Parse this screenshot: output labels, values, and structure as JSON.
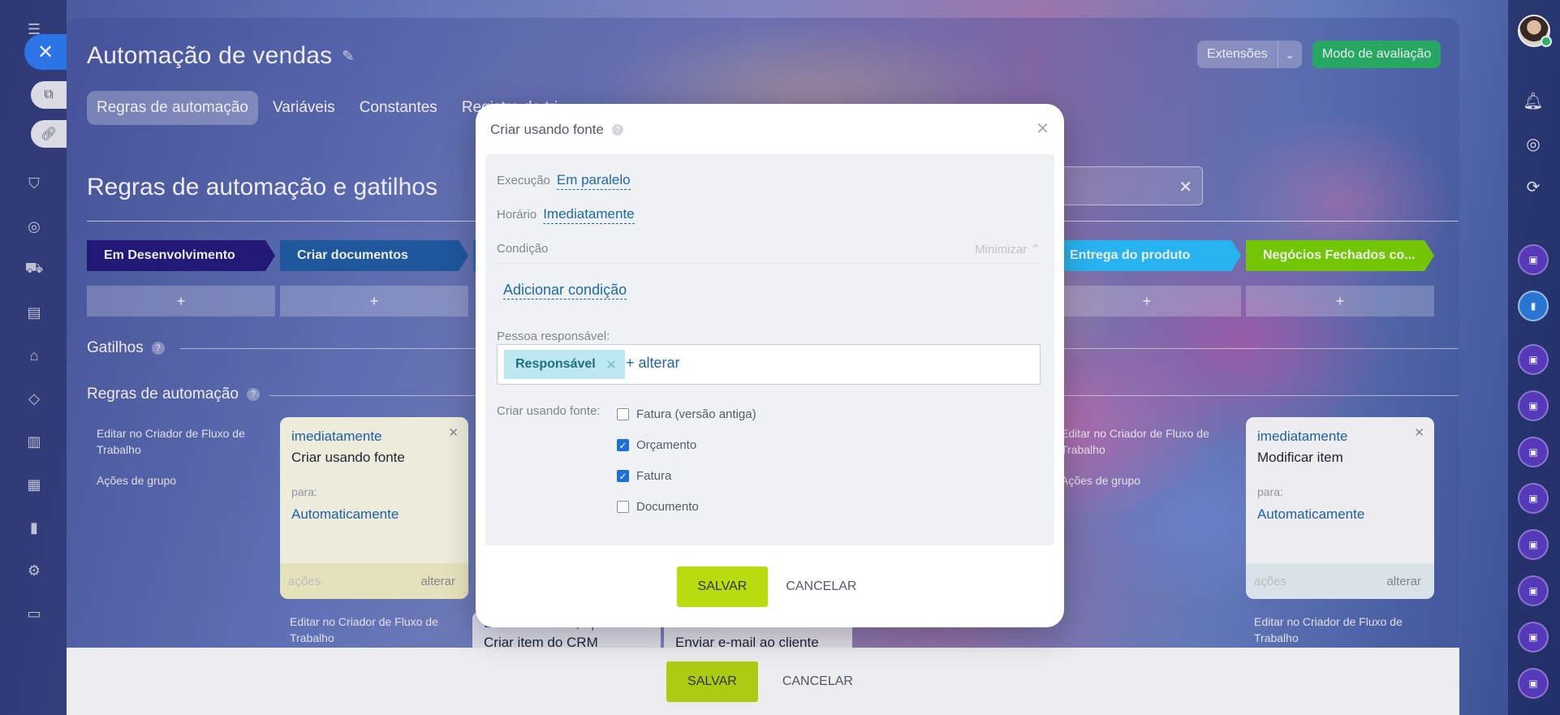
{
  "page": {
    "title": "Automação de vendas",
    "tabs": [
      {
        "label": "Regras de automação"
      },
      {
        "label": "Variáveis"
      },
      {
        "label": "Constantes"
      },
      {
        "label": "Registro de tri"
      }
    ],
    "extensions_label": "Extensões",
    "evaluation_label": "Modo de avaliação",
    "section_title": "Regras de automação e gatilhos"
  },
  "stages": [
    {
      "label": "Em Desenvolvimento",
      "color": "#23187a"
    },
    {
      "label": "Criar documentos",
      "color": "#1f5da3"
    },
    {
      "label": "",
      "color": "#2b72c4"
    },
    {
      "label": "Entrega do produto",
      "color": "#29c1ff"
    },
    {
      "label": "Negócios Fechados co...",
      "color": "#7bd500"
    }
  ],
  "add_label": "+",
  "triggers_label": "Gatilhos",
  "rules_label": "Regras de automação",
  "side_links": {
    "edit_designer": "Editar no Criador de Fluxo de Trabalho",
    "group_actions": "Ações de grupo"
  },
  "cards": [
    {
      "when": "imediatamente",
      "name": "Criar usando fonte",
      "para": "para:",
      "target": "Automaticamente",
      "actions": "ações",
      "alter": "alterar"
    },
    {
      "when": "imediatamente",
      "name": "Modificar item",
      "para": "para:",
      "target": "Automaticamente",
      "actions": "ações",
      "alter": "alterar"
    }
  ],
  "lower_cards": [
    {
      "line1": "Em 10 minutos, após a...",
      "line2": "Criar item do CRM"
    },
    {
      "line1": "imediatamente",
      "line2": "Enviar e-mail ao cliente"
    }
  ],
  "bottom_bar": {
    "save": "SALVAR",
    "cancel": "CANCELAR"
  },
  "modal": {
    "title": "Criar usando fonte",
    "execution_label": "Execução",
    "execution_value": "Em paralelo",
    "time_label": "Horário",
    "time_value": "Imediatamente",
    "condition_label": "Condição",
    "minimize_label": "Minimizar",
    "add_condition": "Adicionar condição",
    "responsible_label": "Pessoa responsável:",
    "responsible_chip": "Responsável",
    "alter_label": "+ alterar",
    "source_label": "Criar usando fonte:",
    "options": [
      {
        "label": "Fatura (versão antiga)",
        "checked": false
      },
      {
        "label": "Orçamento",
        "checked": true
      },
      {
        "label": "Fatura",
        "checked": true
      },
      {
        "label": "Documento",
        "checked": false
      }
    ],
    "save": "SALVAR",
    "cancel": "CANCELAR"
  },
  "icons": {
    "close": "close-icon",
    "pin": "pin-icon",
    "help": "help-icon",
    "bell": "bell-icon"
  }
}
